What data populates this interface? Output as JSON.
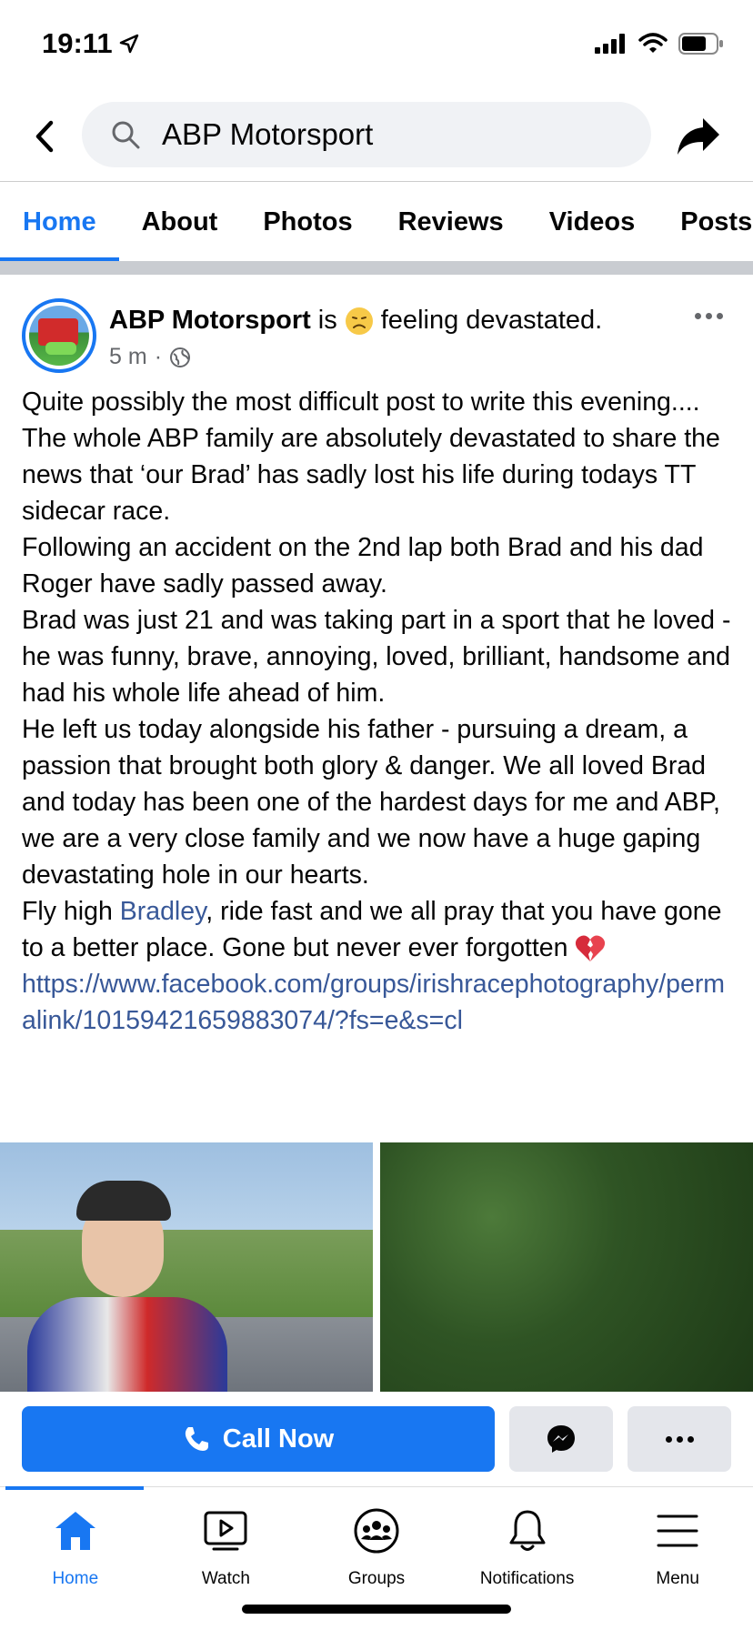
{
  "status_bar": {
    "time": "19:11"
  },
  "search": {
    "query": "ABP Motorsport"
  },
  "tabs": [
    {
      "label": "Home",
      "active": true
    },
    {
      "label": "About"
    },
    {
      "label": "Photos"
    },
    {
      "label": "Reviews"
    },
    {
      "label": "Videos"
    },
    {
      "label": "Posts"
    }
  ],
  "post": {
    "author": "ABP Motorsport",
    "feeling_prefix": "is",
    "feeling_text": "feeling devastated.",
    "time": "5 m",
    "separator": "·",
    "paragraphs": [
      "Quite possibly the most difficult post to write this evening....",
      "The whole ABP family are absolutely devastated to share the news that ‘our Brad’ has sadly lost his life during todays TT sidecar race.",
      "Following an accident on the 2nd lap both Brad and his dad Roger have sadly passed away.",
      "Brad was just 21 and was taking part in a sport that he loved - he was funny, brave, annoying, loved, brilliant, handsome and had his whole life ahead of him.",
      "He left us today alongside his father - pursuing a dream, a passion that brought both glory & danger. We all loved Brad and today has been one of the hardest days for me and ABP, we are a very close family and we now have a huge gaping devastating hole in our hearts."
    ],
    "last_paragraph_start": "Fly high ",
    "mention": "Bradley",
    "last_paragraph_end": ", ride fast and we all pray that you have gone to a better place. Gone but never ever forgotten ",
    "url": "https://www.facebook.com/groups/irishracephotography/permalink/10159421659883074/?fs=e&s=cl"
  },
  "actions": {
    "call_label": "Call Now"
  },
  "bottom_nav": [
    {
      "label": "Home",
      "icon": "home-icon",
      "active": true
    },
    {
      "label": "Watch",
      "icon": "watch-icon"
    },
    {
      "label": "Groups",
      "icon": "groups-icon"
    },
    {
      "label": "Notifications",
      "icon": "bell-icon"
    },
    {
      "label": "Menu",
      "icon": "menu-icon"
    }
  ],
  "colors": {
    "accent": "#1877f2",
    "link": "#385898",
    "secondary_text": "#65676b"
  }
}
